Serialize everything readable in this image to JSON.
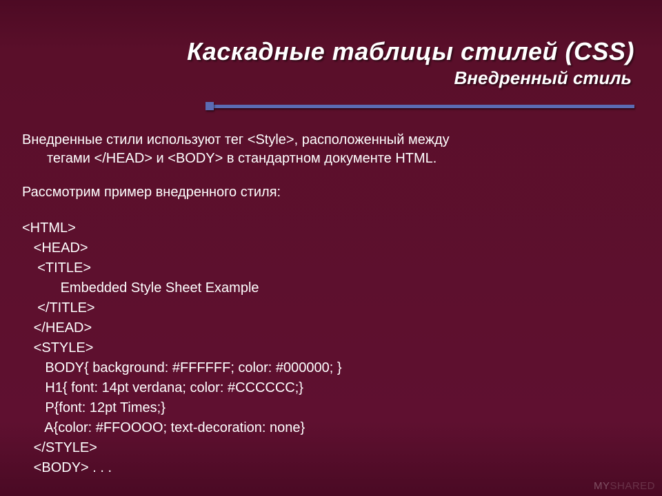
{
  "heading": {
    "title": "Каскадные таблицы стилей (CSS)",
    "subtitle": "Внедренный стиль"
  },
  "body": {
    "para1_line1": "Внедренные стили используют тег <Style>, расположенный между",
    "para1_line2": "тегами </HEAD> и <BODY> в стандартном документе HTML.",
    "para2": "Рассмотрим пример внедренного стиля:",
    "code": "<HTML>\n   <HEAD>\n    <TITLE>\n          Embedded Style Sheet Example\n    </TITLE>\n   </HEAD>\n   <STYLE>\n      BODY{ background: #FFFFFF; color: #000000; }\n      H1{ font: 14pt verdana; color: #CCCCCC;}\n      P{font: 12pt Times;}\n      A{color: #FFOOOO; text-decoration: none}\n   </STYLE>\n   <BODY> . . ."
  },
  "watermark": {
    "part1": "MY",
    "part2": "SHARED"
  }
}
